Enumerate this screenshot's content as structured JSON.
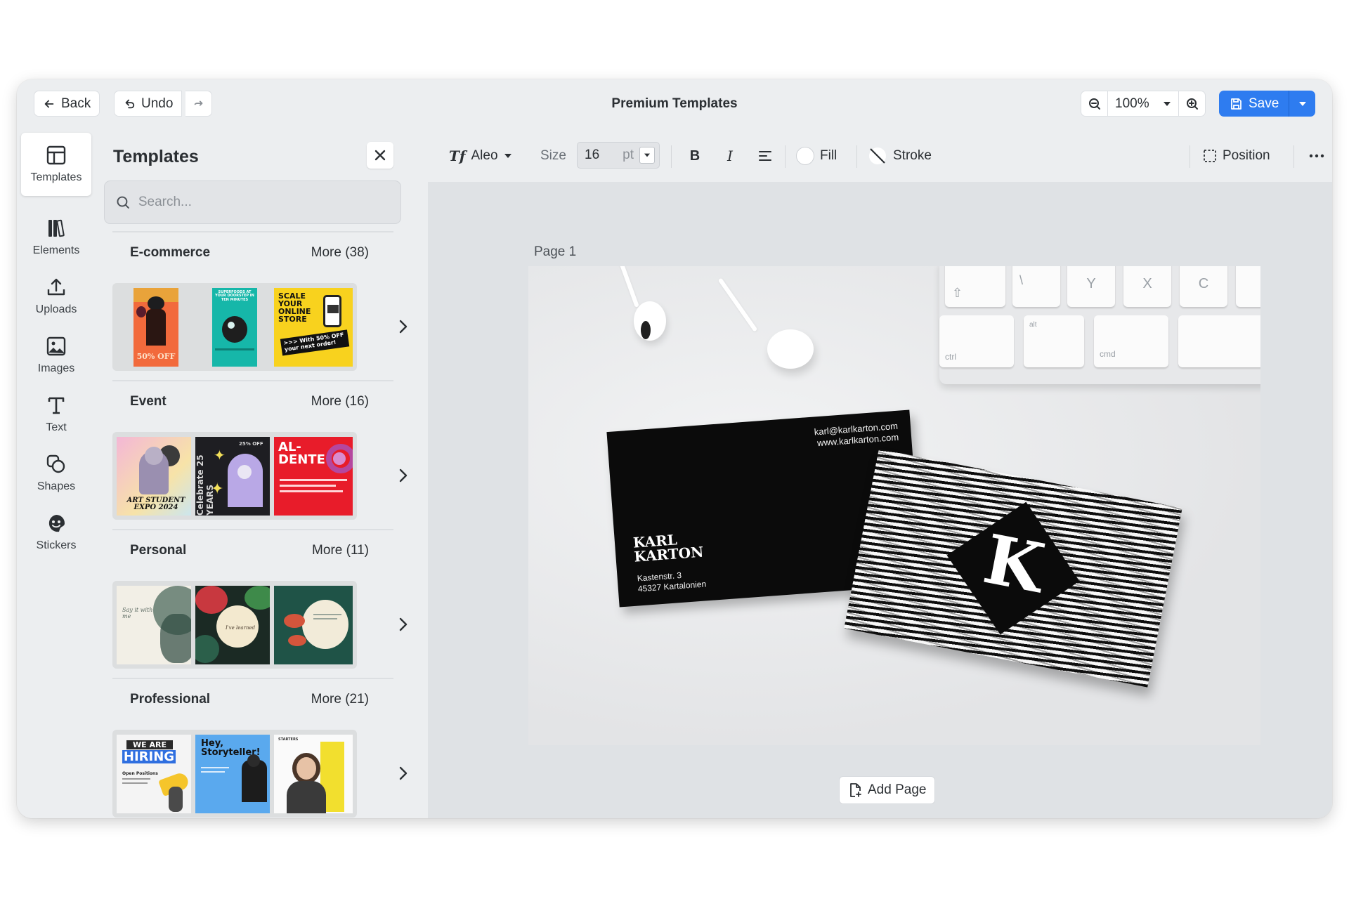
{
  "topbar": {
    "back_label": "Back",
    "undo_label": "Undo",
    "title": "Premium Templates",
    "zoom_value": "100%",
    "save_label": "Save"
  },
  "rail": {
    "items": [
      {
        "label": "Templates",
        "icon": "layout-icon"
      },
      {
        "label": "Elements",
        "icon": "elements-icon"
      },
      {
        "label": "Uploads",
        "icon": "upload-icon"
      },
      {
        "label": "Images",
        "icon": "image-icon"
      },
      {
        "label": "Text",
        "icon": "text-icon"
      },
      {
        "label": "Shapes",
        "icon": "shapes-icon"
      },
      {
        "label": "Stickers",
        "icon": "sticker-icon"
      }
    ]
  },
  "panel": {
    "title": "Templates",
    "search_placeholder": "Search...",
    "categories": [
      {
        "name": "E-commerce",
        "more": "More (38)"
      },
      {
        "name": "Event",
        "more": "More (16)"
      },
      {
        "name": "Personal",
        "more": "More (11)"
      },
      {
        "name": "Professional",
        "more": "More (21)"
      }
    ],
    "posters": {
      "ecom_2": "SUPERFOODS AT YOUR DOORSTEP IN TEN MINUTES",
      "ecom_3_title": "SCALE YOUR ONLINE STORE",
      "ecom_3_offer": ">>> With 50% OFF your next order!",
      "ecom_1_offer": "50% OFF",
      "event_1": "ART STUDENT EXPO 2024",
      "event_2_side": "Celebrate 25 YEARS",
      "event_2_top": "25% OFF",
      "event_3": "AL-DENTE",
      "personal_1": "Say it with me",
      "personal_2": "I've learned",
      "prof_1_a": "WE ARE",
      "prof_1_b": "HIRING",
      "prof_1_c": "Open Positions",
      "prof_2": "Hey, Storyteller!",
      "prof_3": "STARTERS"
    }
  },
  "toolbar": {
    "font_name": "Aleo",
    "size_label": "Size",
    "size_value": "16",
    "size_unit": "pt",
    "fill_label": "Fill",
    "stroke_label": "Stroke",
    "position_label": "Position"
  },
  "canvas": {
    "page_label": "Page  1",
    "add_page_label": "Add Page",
    "card_email": "karl@karlkarton.com",
    "card_web": "www.karlkarton.com",
    "card_name_1": "KARL",
    "card_name_2": "KARTON",
    "card_addr_1": "Kastenstr. 3",
    "card_addr_2": "45327 Kartalonien",
    "card_letter": "K",
    "keys": [
      "Y",
      "X",
      "C",
      "ctrl",
      "alt",
      "cmd"
    ]
  },
  "colors": {
    "accent": "#2e7cf0",
    "frame_bg": "#eceef0",
    "canvas_bg": "#dfe2e5"
  }
}
